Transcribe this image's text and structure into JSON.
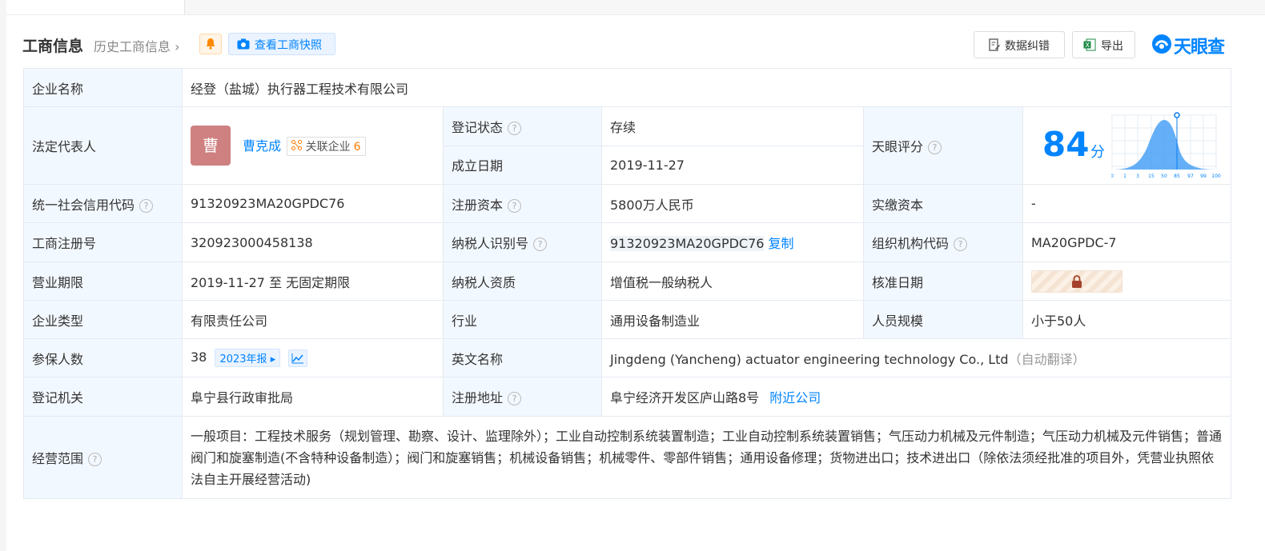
{
  "header": {
    "title": "工商信息",
    "history_link": "历史工商信息",
    "snapshot_button": "查看工商快照",
    "data_fix_button": "数据纠错",
    "export_button": "导出",
    "brand": "天眼查"
  },
  "info": {
    "company_name_label": "企业名称",
    "company_name": "经登（盐城）执行器工程技术有限公司",
    "legal_rep_label": "法定代表人",
    "legal_rep_avatar": "曹",
    "legal_rep_name": "曹克成",
    "related_label": "关联企业",
    "related_count": "6",
    "reg_status_label": "登记状态",
    "reg_status": "存续",
    "founded_label": "成立日期",
    "founded": "2019-11-27",
    "score_label": "天眼评分",
    "score": "84",
    "score_unit": "分",
    "score_ticks": [
      "0",
      "1",
      "3",
      "15",
      "50",
      "85",
      "97",
      "99",
      "100"
    ],
    "credit_code_label": "统一社会信用代码",
    "credit_code": "91320923MA20GPDC76",
    "reg_capital_label": "注册资本",
    "reg_capital": "5800万人民币",
    "paid_capital_label": "实缴资本",
    "paid_capital": "-",
    "biz_reg_no_label": "工商注册号",
    "biz_reg_no": "320923000458138",
    "taxpayer_id_label": "纳税人识别号",
    "taxpayer_id": "91320923MA20GPDC76",
    "copy_label": "复制",
    "org_code_label": "组织机构代码",
    "org_code": "MA20GPDC-7",
    "term_label": "营业期限",
    "term": "2019-11-27 至 无固定期限",
    "taxpayer_qual_label": "纳税人资质",
    "taxpayer_qual": "增值税一般纳税人",
    "approval_date_label": "核准日期",
    "company_type_label": "企业类型",
    "company_type": "有限责任公司",
    "industry_label": "行业",
    "industry": "通用设备制造业",
    "staff_size_label": "人员规模",
    "staff_size": "小于50人",
    "insured_label": "参保人数",
    "insured": "38",
    "report_tag": "2023年报",
    "english_name_label": "英文名称",
    "english_name": "Jingdeng (Yancheng) actuator engineering technology Co., Ltd",
    "auto_translate": "（自动翻译）",
    "authority_label": "登记机关",
    "authority": "阜宁县行政审批局",
    "address_label": "注册地址",
    "address": "阜宁经济开发区庐山路8号",
    "nearby_link": "附近公司",
    "scope_label": "经营范围",
    "scope": "一般项目：工程技术服务（规划管理、勘察、设计、监理除外）；工业自动控制系统装置制造；工业自动控制系统装置销售；气压动力机械及元件制造；气压动力机械及元件销售；普通阀门和旋塞制造(不含特种设备制造）；阀门和旋塞销售；机械设备销售；机械零件、零部件销售；通用设备修理；货物进出口；技术进出口（除依法须经批准的项目外，凭营业执照依法自主开展经营活动)"
  },
  "colors": {
    "accent": "#0084ff",
    "status_green": "#00a05c",
    "key_bg": "#f2f8ff",
    "avatar_bg": "#cf8080"
  }
}
